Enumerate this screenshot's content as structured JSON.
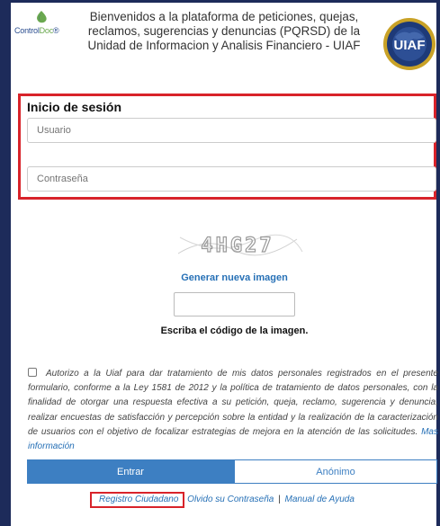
{
  "header": {
    "logo_brand_a": "Control",
    "logo_brand_b": "Doc",
    "logo_trademark": "®",
    "title_line1": "Bienvenidos a la plataforma de peticiones, quejas,",
    "title_line2": "reclamos, sugerencias y denuncias (PQRSD) de la",
    "title_line3": "Unidad de Informacion y Analisis Financiero - UIAF",
    "seal_text": "UIAF",
    "seal_ring_top": "UNIDAD DE INFORMACIÓN Y ANÁLISIS FINANCIERO",
    "seal_ring_bottom": "REPÚBLICA DE COLOMBIA"
  },
  "login": {
    "title": "Inicio de sesión",
    "user_placeholder": "Usuario",
    "pass_placeholder": "Contraseña"
  },
  "captcha": {
    "code": "4HG27",
    "generate_label": "Generar nueva imagen",
    "caption": "Escriba el código de la imagen.",
    "input_value": ""
  },
  "consent": {
    "checked": false,
    "text": "Autorizo a la Uiaf para dar tratamiento de mis datos personales registrados en el presente formulario, conforme a la Ley 1581 de 2012 y la política de tratamiento de datos personales, con la finalidad de otorgar una respuesta efectiva a su petición, queja, reclamo, sugerencia y denuncia, realizar encuestas de satisfacción y percepción sobre la entidad y la realización de la caracterización de usuarios con el objetivo de focalizar estrategias de mejora en la atención de las solicitudes. ",
    "more_info": "Mas información"
  },
  "buttons": {
    "enter": "Entrar",
    "anonymous": "Anónimo"
  },
  "footer": {
    "register": "Registro Ciudadano",
    "forgot": "Olvido su Contraseña",
    "separator": "|",
    "manual": "Manual de Ayuda"
  },
  "colors": {
    "navy": "#1d2b5a",
    "accent_blue": "#3d7fc2",
    "link_blue": "#2670b6",
    "highlight_red": "#d8232a"
  }
}
